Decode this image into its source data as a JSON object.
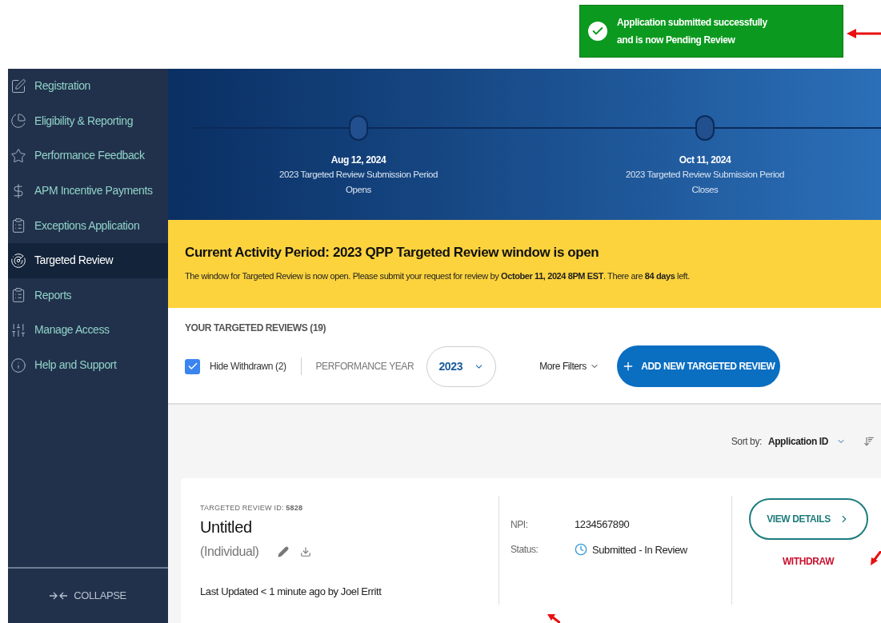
{
  "toast": {
    "text": "Application submitted successfully and is now **Pending Review**"
  },
  "sidebar": {
    "items": [
      {
        "label": "Registration",
        "selected": false
      },
      {
        "label": "Eligibility & Reporting",
        "selected": false
      },
      {
        "label": "Performance Feedback",
        "selected": false
      },
      {
        "label": "APM Incentive Payments",
        "selected": false
      },
      {
        "label": "Exceptions Application",
        "selected": false
      },
      {
        "label": "Targeted Review",
        "selected": true
      },
      {
        "label": "Reports",
        "selected": false
      },
      {
        "label": "Manage Access",
        "selected": false
      },
      {
        "label": "Help and Support",
        "selected": false
      }
    ],
    "collapse": "COLLAPSE"
  },
  "timeline": [
    {
      "date": "Aug 12, 2024",
      "label": "2023 Targeted Review Submission Period Opens"
    },
    {
      "date": "Oct 11, 2024",
      "label": "2023 Targeted Review Submission Period Closes"
    }
  ],
  "banner": {
    "title": "Current Activity Period: 2023 QPP Targeted Review window is open",
    "text": "The window for Targeted Review is now open. Please submit your request for review by **October 11, 2024 8PM EST**. There are **84 days** left."
  },
  "reviews": {
    "heading": "YOUR TARGETED REVIEWS (19)",
    "hide_withdrawn": {
      "label": "Hide Withdrawn (2)",
      "checked": true
    },
    "performance_year": {
      "label": "PERFORMANCE YEAR",
      "value": "2023"
    },
    "more_filters": "More Filters",
    "add_button": "ADD NEW TARGETED REVIEW",
    "sort": {
      "label": "Sort by:",
      "value": "Application ID"
    }
  },
  "card": {
    "id_label": "TARGETED REVIEW ID: **5828**",
    "title": "Untitled",
    "type": "(Individual)",
    "last_updated": "Last Updated < 1 minute ago by Joel Erritt",
    "fields": [
      {
        "label": "NPI:",
        "value": "1234567890",
        "kind": "text"
      },
      {
        "label": "Status:",
        "value": "Submitted - In Review",
        "kind": "status"
      }
    ],
    "view_button": "VIEW DETAILS",
    "withdraw": "WITHDRAW"
  }
}
